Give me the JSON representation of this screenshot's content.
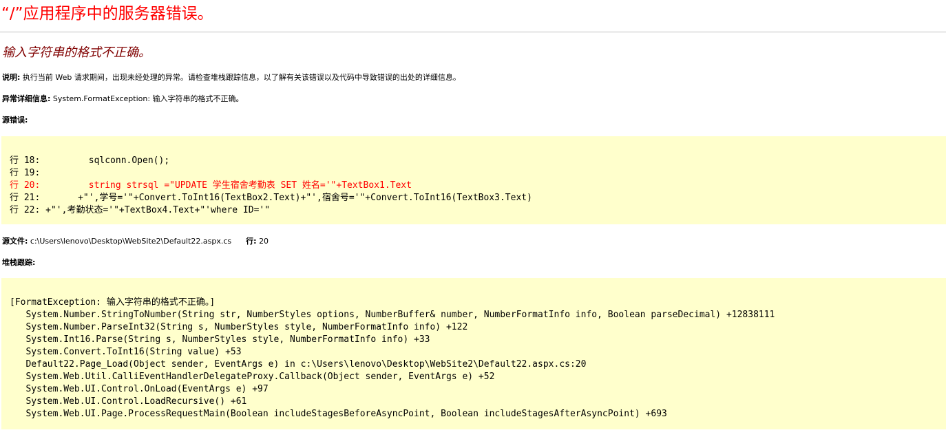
{
  "app_title": "“/”应用程序中的服务器错误。",
  "error_message": "输入字符串的格式不正确。",
  "description": {
    "label": "说明:",
    "text": "执行当前 Web 请求期间，出现未经处理的异常。请检查堆栈跟踪信息，以了解有关该错误以及代码中导致错误的出处的详细信息。"
  },
  "exception_details": {
    "label": "异常详细信息:",
    "text": "System.FormatException: 输入字符串的格式不正确。"
  },
  "source_error": {
    "label": "源错误:",
    "lines": [
      {
        "text": "行 18:         sqlconn.Open();",
        "highlight": false
      },
      {
        "text": "行 19: ",
        "highlight": false
      },
      {
        "text": "行 20:         string strsql =\"UPDATE 学生宿舍考勤表 SET 姓名='\"+TextBox1.Text",
        "highlight": true
      },
      {
        "text": "行 21:       +\"',学号='\"+Convert.ToInt16(TextBox2.Text)+\"',宿舍号='\"+Convert.ToInt16(TextBox3.Text)",
        "highlight": false
      },
      {
        "text": "行 22: +\"',考勤状态='\"+TextBox4.Text+\"'where ID='\"",
        "highlight": false
      }
    ]
  },
  "source_file": {
    "label": "源文件:",
    "path": "c:\\Users\\lenovo\\Desktop\\WebSite2\\Default22.aspx.cs",
    "line_label": "行:",
    "line_number": "20"
  },
  "stack_trace": {
    "label": "堆栈跟踪:",
    "lines": [
      "[FormatException: 输入字符串的格式不正确。]",
      "   System.Number.StringToNumber(String str, NumberStyles options, NumberBuffer& number, NumberFormatInfo info, Boolean parseDecimal) +12838111",
      "   System.Number.ParseInt32(String s, NumberStyles style, NumberFormatInfo info) +122",
      "   System.Int16.Parse(String s, NumberStyles style, NumberFormatInfo info) +33",
      "   System.Convert.ToInt16(String value) +53",
      "   Default22.Page_Load(Object sender, EventArgs e) in c:\\Users\\lenovo\\Desktop\\WebSite2\\Default22.aspx.cs:20",
      "   System.Web.Util.CalliEventHandlerDelegateProxy.Callback(Object sender, EventArgs e) +52",
      "   System.Web.UI.Control.OnLoad(EventArgs e) +97",
      "   System.Web.UI.Control.LoadRecursive() +61",
      "   System.Web.UI.Page.ProcessRequestMain(Boolean includeStagesBeforeAsyncPoint, Boolean includeStagesAfterAsyncPoint) +693"
    ]
  },
  "colors": {
    "title": "#ff0000",
    "error_message": "#800000",
    "code_background": "#ffffcc",
    "highlight_line": "#ff0000",
    "divider": "#c0c0c0"
  }
}
